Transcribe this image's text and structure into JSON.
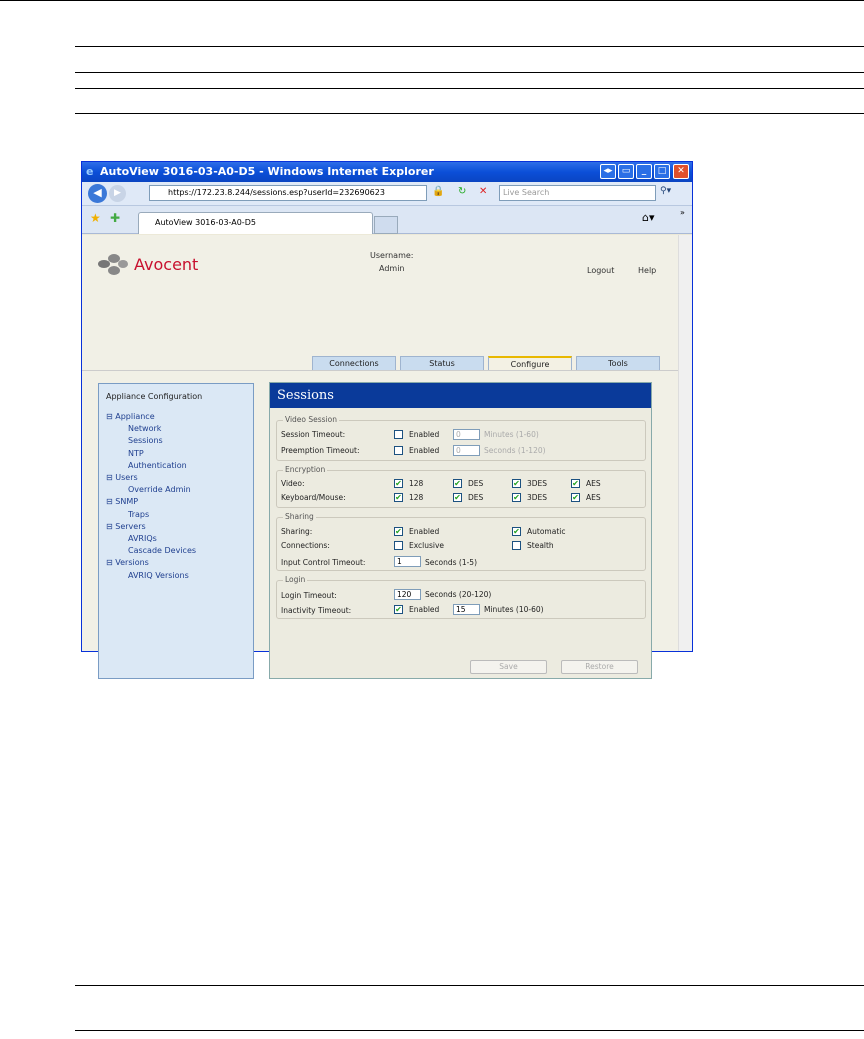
{
  "browser": {
    "title": "AutoView 3016-03-A0-D5 - Windows Internet Explorer",
    "url": "https://172.23.8.244/sessions.esp?userId=232690623",
    "search_placeholder": "Live Search",
    "tab": "AutoView 3016-03-A0-D5"
  },
  "header": {
    "brand": "Avocent",
    "username_label": "Username:",
    "username": "Admin",
    "logout": "Logout",
    "help": "Help"
  },
  "nav": [
    "Connections",
    "Status",
    "Configure",
    "Tools"
  ],
  "sidebar": {
    "title": "Appliance Configuration",
    "items": [
      {
        "label": "Appliance",
        "children": [
          "Network",
          "Sessions",
          "NTP",
          "Authentication"
        ]
      },
      {
        "label": "Users",
        "children": [
          "Override Admin"
        ]
      },
      {
        "label": "SNMP",
        "children": [
          "Traps"
        ]
      },
      {
        "label": "Servers",
        "children": [
          "AVRIQs",
          "Cascade Devices"
        ]
      },
      {
        "label": "Versions",
        "children": [
          "AVRIQ Versions"
        ]
      }
    ]
  },
  "main": {
    "title": "Sessions",
    "video": {
      "legend": "Video Session",
      "session_timeout": "Session Timeout:",
      "preemption_timeout": "Preemption Timeout:",
      "enabled": "Enabled",
      "session_value": "0",
      "session_unit": "Minutes (1-60)",
      "preemption_value": "0",
      "preemption_unit": "Seconds (1-120)"
    },
    "encryption": {
      "legend": "Encryption",
      "video": "Video:",
      "km": "Keyboard/Mouse:",
      "options": [
        "128",
        "DES",
        "3DES",
        "AES"
      ]
    },
    "sharing": {
      "legend": "Sharing",
      "sharing": "Sharing:",
      "connections": "Connections:",
      "enabled": "Enabled",
      "automatic": "Automatic",
      "exclusive": "Exclusive",
      "stealth": "Stealth",
      "ict": "Input Control Timeout:",
      "ict_value": "1",
      "ict_unit": "Seconds (1-5)"
    },
    "login": {
      "legend": "Login",
      "login_timeout": "Login Timeout:",
      "login_value": "120",
      "login_unit": "Seconds (20-120)",
      "inactivity": "Inactivity Timeout:",
      "enabled": "Enabled",
      "inactivity_value": "15",
      "inactivity_unit": "Minutes (10-60)"
    },
    "save": "Save",
    "restore": "Restore"
  }
}
